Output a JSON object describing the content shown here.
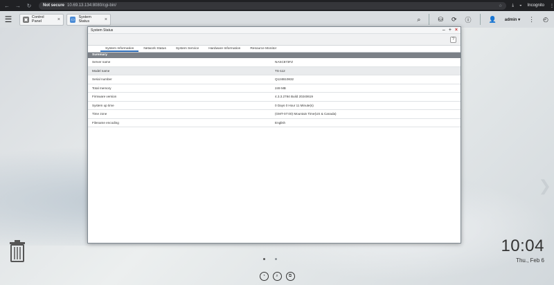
{
  "browser": {
    "security": "Not secure",
    "url": "10.69.13.134:8080/cgi-bin/",
    "profile": "Incognito"
  },
  "taskbar": {
    "tabs": [
      {
        "label": "Control Panel"
      },
      {
        "label": "System Status"
      }
    ],
    "user": "admin ▾"
  },
  "window": {
    "title": "System Status",
    "help": "?",
    "tabs": [
      "System Information",
      "Network Status",
      "System Service",
      "Hardware Information",
      "Resource Monitor"
    ],
    "section": "Summary",
    "rows": [
      {
        "key": "Server name",
        "value": "NASC873FZ"
      },
      {
        "key": "Model name",
        "value": "TS-112"
      },
      {
        "key": "Serial number",
        "value": "Q124B10832"
      },
      {
        "key": "Total memory",
        "value": "249 MB"
      },
      {
        "key": "Firmware version",
        "value": "4.3.3.2784 Build 20240619"
      },
      {
        "key": "System up time",
        "value": "0 Days 0 Hour 11 Minute(s)"
      },
      {
        "key": "Time zone",
        "value": "(GMT-07:00) Mountain Time(US & Canada)"
      },
      {
        "key": "Filename encoding",
        "value": "English"
      }
    ]
  },
  "desktop": {
    "time": "10:04",
    "date": "Thu., Feb 6"
  }
}
